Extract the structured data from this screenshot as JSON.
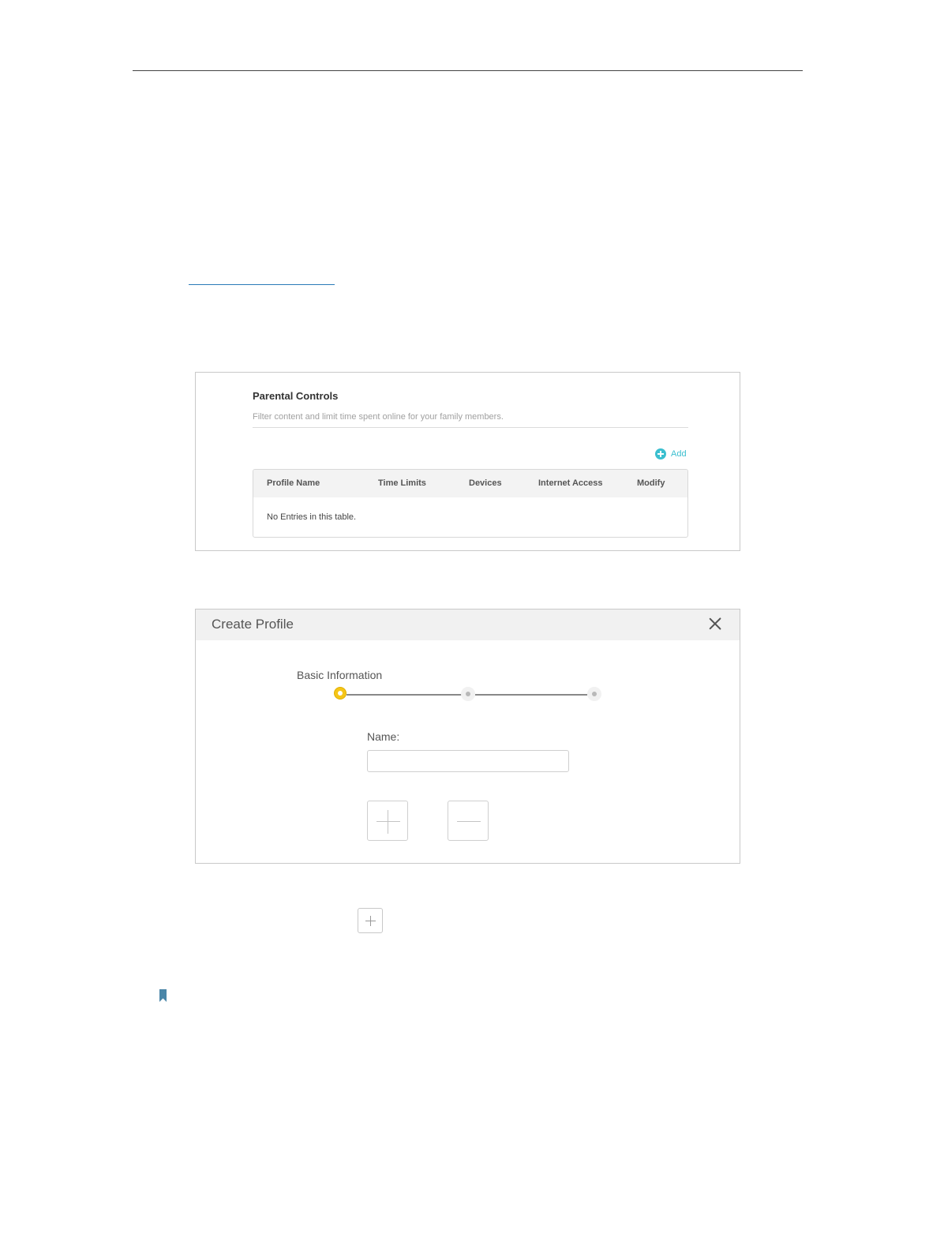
{
  "parental_controls": {
    "title": "Parental Controls",
    "subtitle": "Filter content and limit time spent online for your family members.",
    "add_label": "Add",
    "table": {
      "columns": [
        "Profile Name",
        "Time Limits",
        "Devices",
        "Internet Access",
        "Modify"
      ],
      "empty_message": "No Entries in this table."
    }
  },
  "create_profile": {
    "title": "Create Profile",
    "step_label": "Basic Information",
    "name_label": "Name:",
    "name_value": "",
    "steps_total": 3,
    "current_step": 1
  },
  "colors": {
    "accent": "#3bbfcf",
    "step_active": "#f5c518",
    "note_icon": "#4a86a8",
    "link": "#2a7ab8"
  },
  "icons": {
    "add": "plus-circle-icon",
    "close": "close-icon",
    "add_device": "plus-icon",
    "remove_device": "minus-icon",
    "note": "bookmark-icon"
  }
}
